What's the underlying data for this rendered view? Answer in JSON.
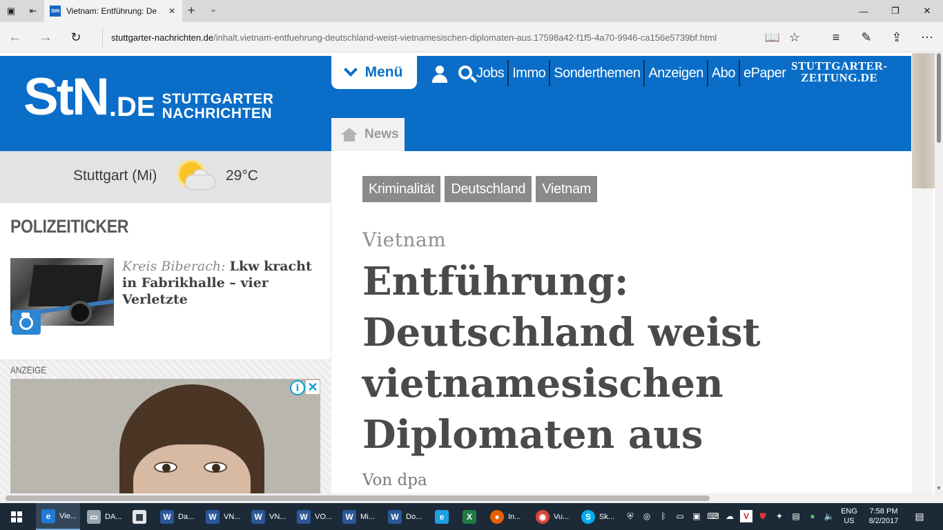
{
  "browser": {
    "tab_title": "Vietnam: Entführung: De",
    "tab_favicon_text": "StN",
    "url_domain": "stuttgarter-nachrichten.de",
    "url_path": "/inhalt.vietnam-entfuehrung-deutschland-weist-vietnamesischen-diplomaten-aus.17598a42-f1f5-4a70-9946-ca156e5739bf.html"
  },
  "site": {
    "logo_main": "StN",
    "logo_de": ".DE",
    "logo_sub_line1": "STUTTGARTER",
    "logo_sub_line2": "NACHRICHTEN",
    "menu_label": "Menü",
    "nav": [
      "Jobs",
      "Immo",
      "Sonderthemen",
      "Anzeigen",
      "Abo",
      "ePaper"
    ],
    "partner_line1": "STUTTGARTER-",
    "partner_line2": "ZEITUNG.DE",
    "news_tab": "News",
    "brand_color": "#0a6ec8"
  },
  "weather": {
    "city": "Stuttgart (Mi)",
    "temperature": "29°C",
    "icon": "sun-cloud-icon"
  },
  "polizeiticker": {
    "title": "POLIZEITICKER",
    "kicker": "Kreis Biberach:",
    "headline": "Lkw kracht in Fabrikhalle – vier Verletzte"
  },
  "ad": {
    "label": "ANZEIGE",
    "info_glyph": "i",
    "close_glyph": "✕"
  },
  "article": {
    "tags": [
      "Kriminalität",
      "Deutschland",
      "Vietnam"
    ],
    "kicker": "Vietnam",
    "headline_lines": [
      "Entführung:",
      "Deutschland weist",
      "vietnamesischen",
      "Diplomaten aus"
    ],
    "byline": "Von dpa"
  },
  "taskbar": {
    "apps": [
      {
        "icon": "edge-icon",
        "label": "Vie..."
      },
      {
        "icon": "drive-icon",
        "label": "DA..."
      },
      {
        "icon": "store-icon",
        "label": ""
      },
      {
        "icon": "word-icon",
        "label": "Da..."
      },
      {
        "icon": "word-icon",
        "label": "VN..."
      },
      {
        "icon": "word-icon",
        "label": "VN..."
      },
      {
        "icon": "word-icon",
        "label": "VO..."
      },
      {
        "icon": "word-icon",
        "label": "Mi..."
      },
      {
        "icon": "word-icon",
        "label": "Do..."
      },
      {
        "icon": "ie-icon",
        "label": ""
      },
      {
        "icon": "excel-icon",
        "label": ""
      },
      {
        "icon": "firefox-icon",
        "label": "In..."
      },
      {
        "icon": "chrome-icon",
        "label": "Vu..."
      },
      {
        "icon": "skype-icon",
        "label": "Sk..."
      }
    ],
    "lang_line1": "ENG",
    "lang_line2": "US",
    "time": "7:58 PM",
    "date": "8/2/2017"
  }
}
